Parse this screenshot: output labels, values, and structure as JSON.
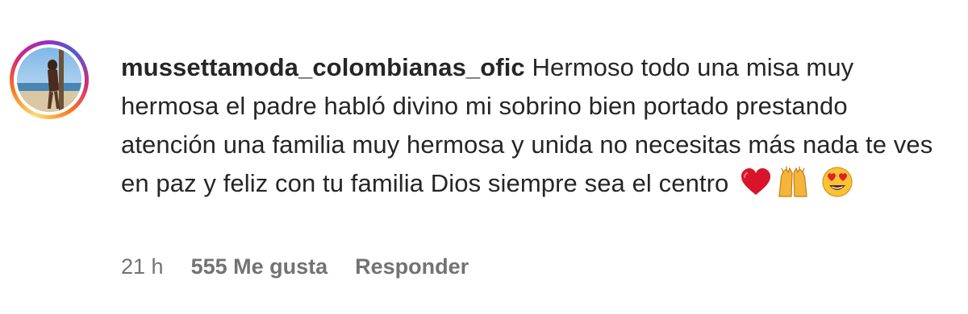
{
  "comment": {
    "username": "mussettamoda_colombianas_ofic",
    "text": "Hermoso todo una misa muy hermosa el padre habló divino mi sobrino bien portado prestando atención una familia muy hermosa y unida no necesitas más nada te ves en paz y feliz con tu familia Dios siempre sea el centro",
    "emojis": [
      "red-heart-icon",
      "raising-hands-icon",
      "heart-eyes-icon"
    ],
    "time": "21 h",
    "likes": "555 Me gusta",
    "reply_label": "Responder"
  },
  "colors": {
    "text": "#262626",
    "meta": "#737373",
    "story_ring_start": "#feda75",
    "story_ring_end": "#d62976"
  }
}
